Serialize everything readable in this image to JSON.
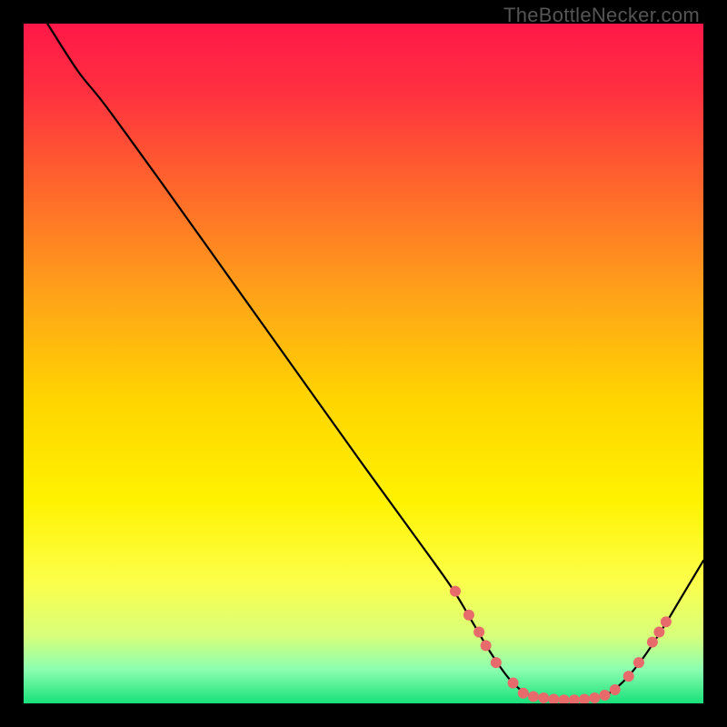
{
  "watermark": "TheBottleNecker.com",
  "chart_data": {
    "type": "line",
    "title": "",
    "xlabel": "",
    "ylabel": "",
    "xlim": [
      0,
      100
    ],
    "ylim": [
      0,
      100
    ],
    "legend": false,
    "grid": false,
    "background": {
      "type": "vertical-gradient",
      "stops": [
        {
          "offset": 0.0,
          "color": "#ff1848"
        },
        {
          "offset": 0.1,
          "color": "#ff3040"
        },
        {
          "offset": 0.25,
          "color": "#ff6a2a"
        },
        {
          "offset": 0.4,
          "color": "#ffa319"
        },
        {
          "offset": 0.55,
          "color": "#ffd400"
        },
        {
          "offset": 0.7,
          "color": "#fff200"
        },
        {
          "offset": 0.82,
          "color": "#fcff4a"
        },
        {
          "offset": 0.9,
          "color": "#d8ff7a"
        },
        {
          "offset": 0.95,
          "color": "#8cffb0"
        },
        {
          "offset": 1.0,
          "color": "#18e07a"
        }
      ]
    },
    "series": [
      {
        "name": "bottleneck-curve",
        "stroke": "#000000",
        "points": [
          {
            "x": 3.5,
            "y": 100.0
          },
          {
            "x": 8.0,
            "y": 93.0
          },
          {
            "x": 12.0,
            "y": 88.0
          },
          {
            "x": 20.0,
            "y": 77.0
          },
          {
            "x": 30.0,
            "y": 63.0
          },
          {
            "x": 40.0,
            "y": 49.0
          },
          {
            "x": 50.0,
            "y": 35.0
          },
          {
            "x": 58.0,
            "y": 24.0
          },
          {
            "x": 63.0,
            "y": 17.0
          },
          {
            "x": 66.0,
            "y": 12.0
          },
          {
            "x": 69.0,
            "y": 7.0
          },
          {
            "x": 72.0,
            "y": 3.0
          },
          {
            "x": 75.0,
            "y": 1.0
          },
          {
            "x": 80.0,
            "y": 0.5
          },
          {
            "x": 85.0,
            "y": 1.0
          },
          {
            "x": 88.0,
            "y": 3.0
          },
          {
            "x": 91.0,
            "y": 6.5
          },
          {
            "x": 94.0,
            "y": 11.0
          },
          {
            "x": 97.0,
            "y": 16.0
          },
          {
            "x": 100.0,
            "y": 21.0
          }
        ]
      }
    ],
    "markers": {
      "name": "highlighted-points",
      "fill": "#e86b6b",
      "points": [
        {
          "x": 63.5,
          "y": 16.5
        },
        {
          "x": 65.5,
          "y": 13.0
        },
        {
          "x": 67.0,
          "y": 10.5
        },
        {
          "x": 68.0,
          "y": 8.5
        },
        {
          "x": 69.5,
          "y": 6.0
        },
        {
          "x": 72.0,
          "y": 3.0
        },
        {
          "x": 73.5,
          "y": 1.5
        },
        {
          "x": 75.0,
          "y": 1.0
        },
        {
          "x": 76.5,
          "y": 0.8
        },
        {
          "x": 78.0,
          "y": 0.6
        },
        {
          "x": 79.5,
          "y": 0.5
        },
        {
          "x": 81.0,
          "y": 0.5
        },
        {
          "x": 82.5,
          "y": 0.6
        },
        {
          "x": 84.0,
          "y": 0.8
        },
        {
          "x": 85.5,
          "y": 1.2
        },
        {
          "x": 87.0,
          "y": 2.0
        },
        {
          "x": 89.0,
          "y": 4.0
        },
        {
          "x": 90.5,
          "y": 6.0
        },
        {
          "x": 92.5,
          "y": 9.0
        },
        {
          "x": 93.5,
          "y": 10.5
        },
        {
          "x": 94.5,
          "y": 12.0
        }
      ]
    }
  }
}
